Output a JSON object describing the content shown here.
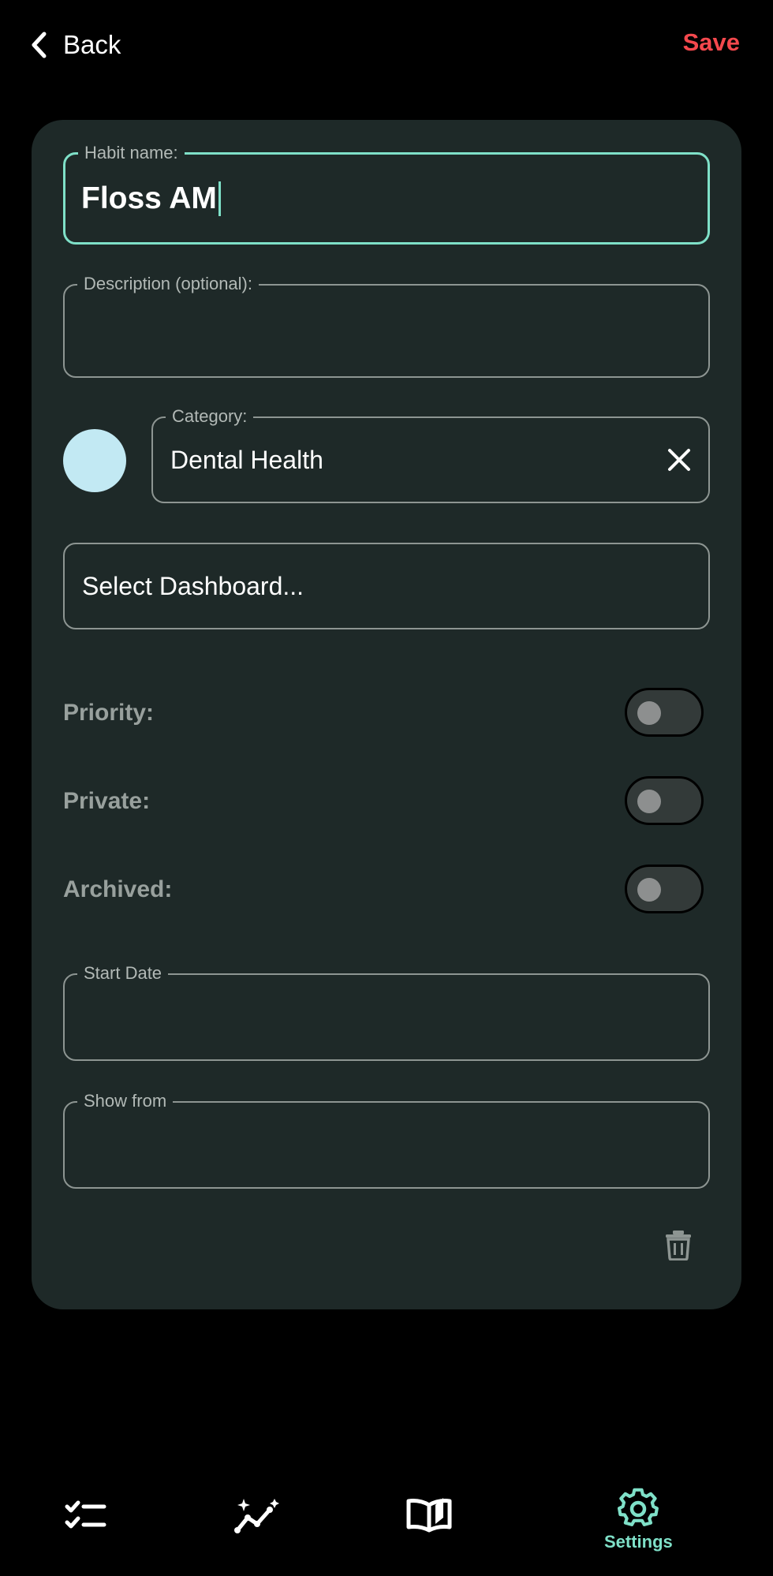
{
  "header": {
    "back_label": "Back",
    "save_label": "Save"
  },
  "form": {
    "habit_name": {
      "legend": "Habit name:",
      "value": "Floss AM"
    },
    "description": {
      "legend": "Description (optional):",
      "value": ""
    },
    "category": {
      "legend": "Category:",
      "value": "Dental Health",
      "color": "#c2e9f3"
    },
    "dashboard": {
      "placeholder": "Select Dashboard..."
    },
    "toggles": [
      {
        "label": "Priority:",
        "on": false
      },
      {
        "label": "Private:",
        "on": false
      },
      {
        "label": "Archived:",
        "on": false
      }
    ],
    "start_date": {
      "legend": "Start Date",
      "value": ""
    },
    "show_from": {
      "legend": "Show from",
      "value": ""
    }
  },
  "nav": {
    "items": [
      {
        "icon": "checklist-icon",
        "label": ""
      },
      {
        "icon": "sparkle-chart-icon",
        "label": ""
      },
      {
        "icon": "open-book-icon",
        "label": ""
      },
      {
        "icon": "gear-icon",
        "label": "Settings",
        "active": true
      }
    ]
  },
  "colors": {
    "accent": "#7fe0c8",
    "save": "#f4484d",
    "card": "#1e2928",
    "background": "#000000"
  }
}
